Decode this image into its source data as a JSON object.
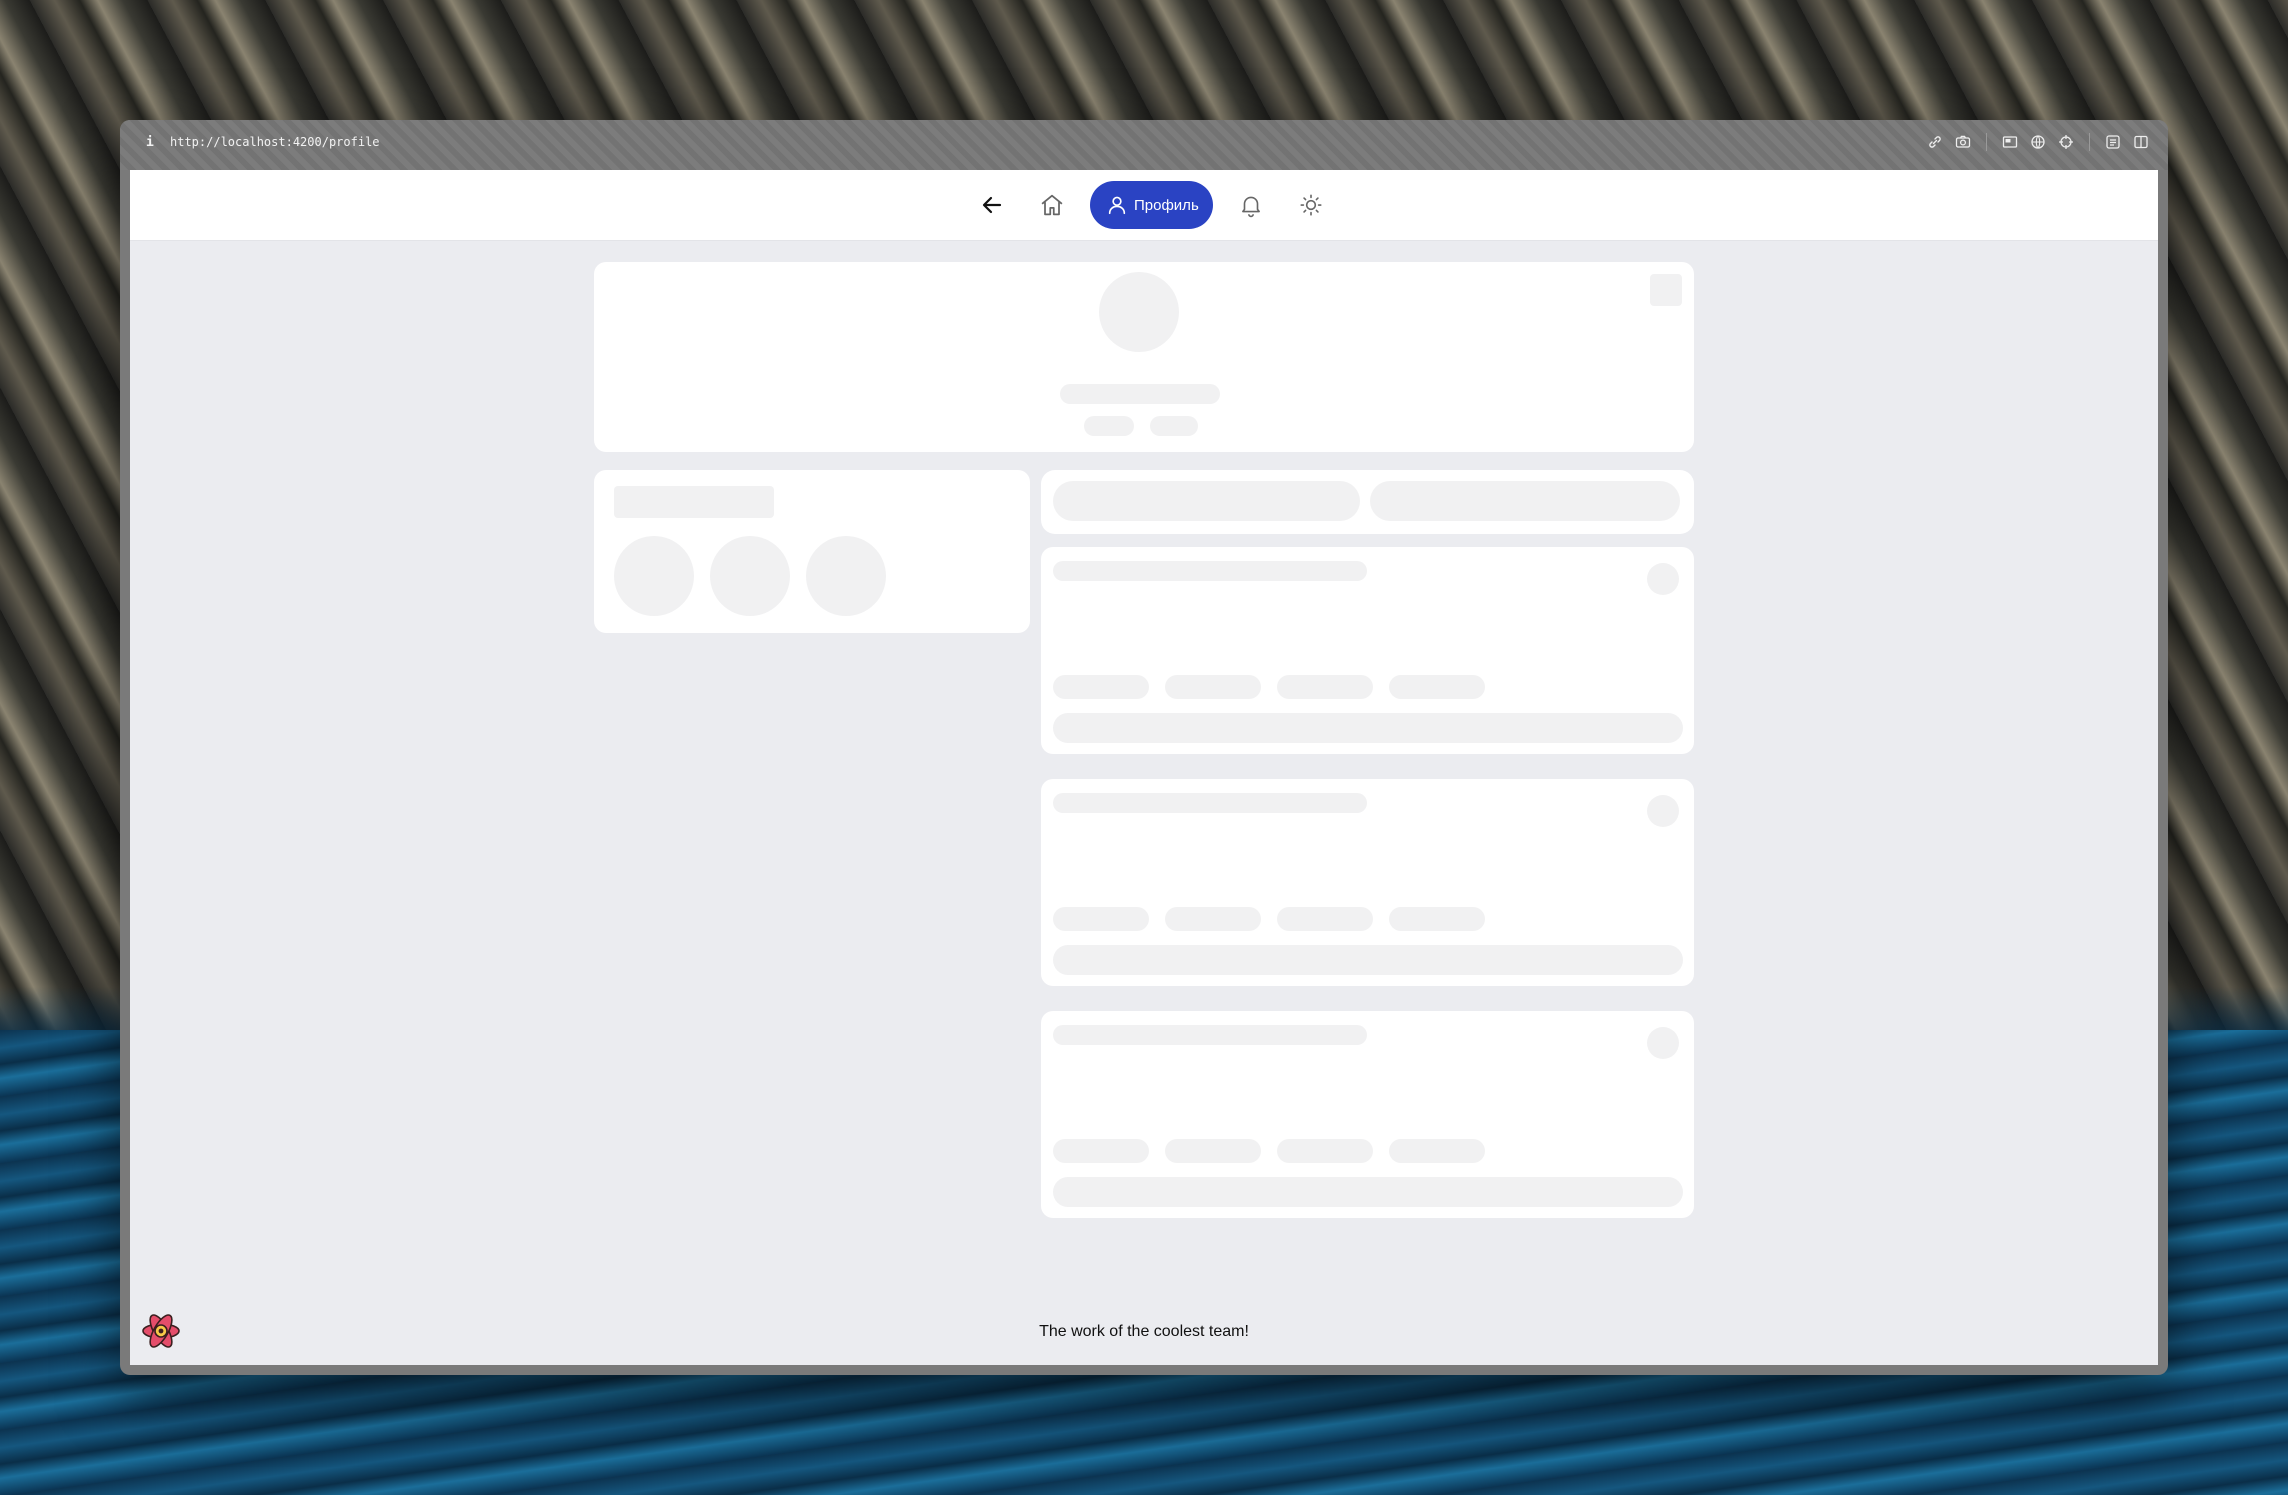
{
  "browser": {
    "info_glyph": "i",
    "url": "http://localhost:4200/profile",
    "toolbar_icons": [
      "link-icon",
      "camera-icon",
      "picture-in-picture-icon",
      "globe-icon",
      "crosshair-icon",
      "reader-icon",
      "split-view-icon"
    ]
  },
  "nav": {
    "profile_label": "Профиль",
    "accent_color": "#2a43c3",
    "icons": [
      "back-arrow-icon",
      "home-icon",
      "user-icon",
      "bell-icon",
      "sun-icon"
    ]
  },
  "footer": {
    "text": "The work of the coolest team!",
    "logo_icon": "react-atom-icon"
  }
}
